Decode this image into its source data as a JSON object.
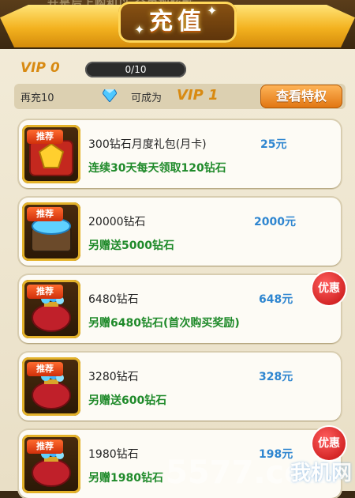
{
  "header": {
    "top_text": "升是后上购和以 全更加炫酷",
    "title": "充值"
  },
  "vip": {
    "label": "VIP 0",
    "progress_text": "0/10",
    "progress": 0.0
  },
  "info": {
    "recharge_prefix": "再充10",
    "become_label": "可成为",
    "next_vip": "VIP 1",
    "privilege_button": "查看特权"
  },
  "items": [
    {
      "tag": "推荐",
      "name": "300钻石月度礼包(月卡)",
      "price": "25元",
      "bonus": "连续30天每天领取120钻石",
      "promo": ""
    },
    {
      "tag": "推荐",
      "name": "20000钻石",
      "price": "2000元",
      "bonus": "另赠送5000钻石",
      "promo": ""
    },
    {
      "tag": "推荐",
      "name": "6480钻石",
      "price": "648元",
      "bonus": "另赠6480钻石(首次购买奖励)",
      "promo": "优惠"
    },
    {
      "tag": "推荐",
      "name": "3280钻石",
      "price": "328元",
      "bonus": "另赠送600钻石",
      "promo": ""
    },
    {
      "tag": "推荐",
      "name": "1980钻石",
      "price": "198元",
      "bonus": "另赠1980钻石",
      "promo": "优惠"
    }
  ],
  "watermark": {
    "site": "5577.com",
    "brand": "我机网"
  },
  "colors": {
    "gold": "#f3b21f",
    "vip_orange": "#d88a12",
    "price_blue": "#2f86d0",
    "bonus_green": "#1f8a2a",
    "promo_red": "#c30f0f"
  }
}
